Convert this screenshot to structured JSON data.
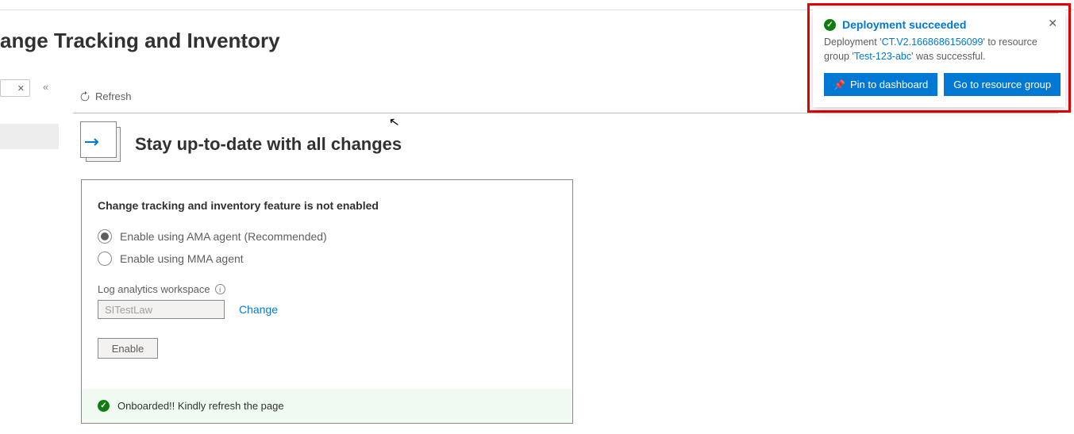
{
  "page": {
    "title": "ange Tracking and Inventory",
    "more_dots": "···"
  },
  "commands": {
    "refresh": "Refresh",
    "close_x": "✕",
    "collapse": "«"
  },
  "hero": {
    "title": "Stay up-to-date with all changes"
  },
  "card": {
    "subtitle": "Change tracking and inventory feature is not enabled",
    "opt_ama": "Enable using AMA agent (Recommended)",
    "opt_mma": "Enable using MMA agent",
    "law_label": "Log analytics workspace",
    "law_value": "SITestLaw",
    "change_link": "Change",
    "enable_btn": "Enable",
    "status_msg": "Onboarded!! Kindly refresh the page"
  },
  "toast": {
    "title": "Deployment succeeded",
    "body_prefix": "Deployment '",
    "deployment_name": "CT.V2.1668686156099",
    "body_mid": "' to resource group '",
    "resource_group": "Test-123-abc",
    "body_suffix": "' was successful.",
    "pin_btn": "Pin to dashboard",
    "goto_btn": "Go to resource group",
    "close": "✕"
  }
}
